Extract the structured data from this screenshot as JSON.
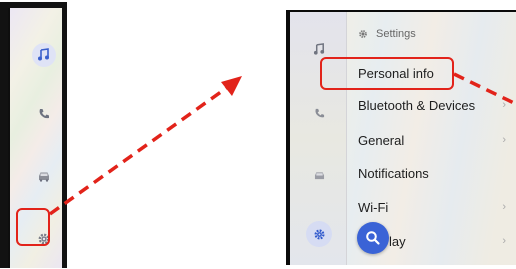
{
  "right_screen": {
    "header": {
      "title": "Settings",
      "icon": "gear-icon"
    },
    "menu_items": [
      {
        "label": "Personal info",
        "chevron": ""
      },
      {
        "label": "Bluetooth & Devices",
        "chevron": "›"
      },
      {
        "label": "General",
        "chevron": "›"
      },
      {
        "label": "Notifications",
        "chevron": ""
      },
      {
        "label": "Wi-Fi",
        "chevron": "›"
      },
      {
        "label": "lay",
        "chevron": "›"
      }
    ],
    "rail_icons": [
      "music-note-icon",
      "phone-icon",
      "car-icon",
      "gear-icon"
    ],
    "search_button_icon": "search-icon"
  },
  "left_screen": {
    "rail_icons": [
      "music-note-icon",
      "phone-icon",
      "car-icon",
      "gear-icon"
    ]
  },
  "annotations": {
    "highlight_color": "#e2231a",
    "accent_color": "#3a63d6"
  }
}
